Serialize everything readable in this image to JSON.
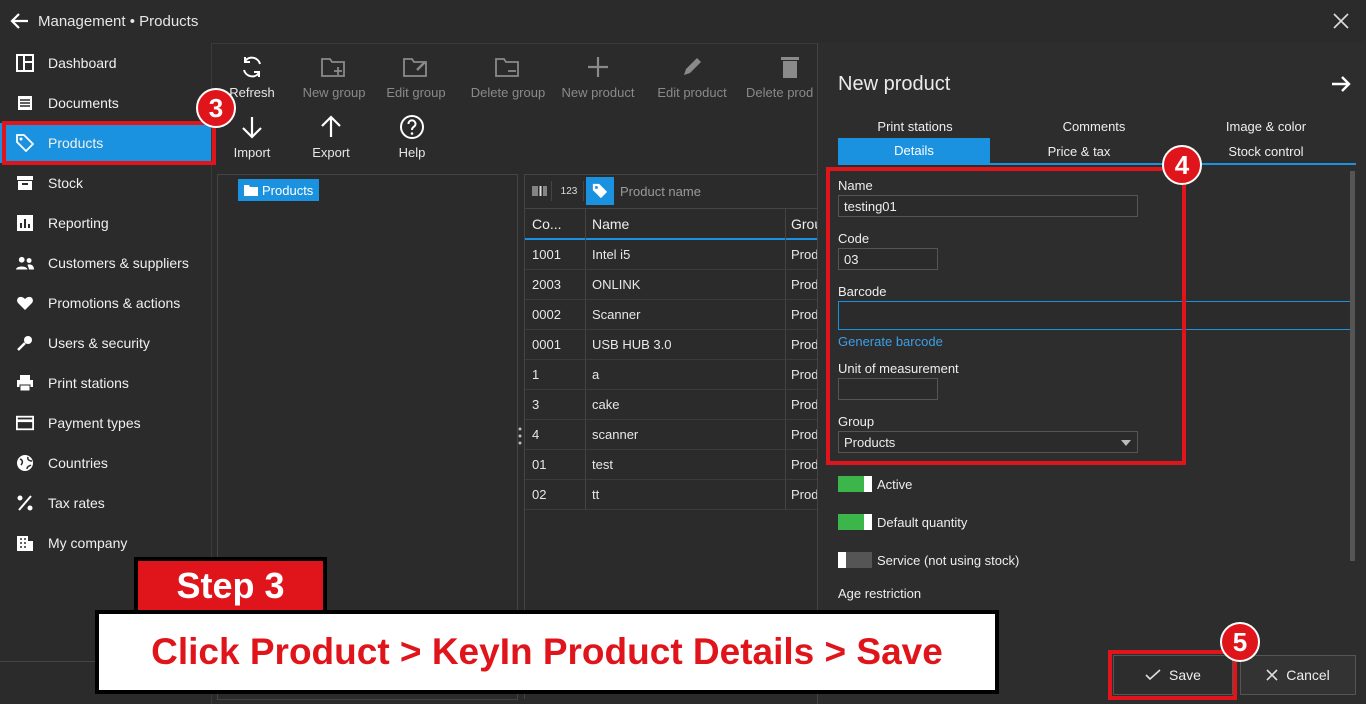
{
  "window": {
    "title": "Management • Products"
  },
  "sidebar": {
    "items": [
      {
        "label": "Dashboard",
        "icon": "dashboard-icon"
      },
      {
        "label": "Documents",
        "icon": "documents-icon"
      },
      {
        "label": "Products",
        "icon": "tag-icon"
      },
      {
        "label": "Stock",
        "icon": "stock-icon"
      },
      {
        "label": "Reporting",
        "icon": "chart-icon"
      },
      {
        "label": "Customers & suppliers",
        "icon": "people-icon"
      },
      {
        "label": "Promotions & actions",
        "icon": "heart-icon"
      },
      {
        "label": "Users & security",
        "icon": "key-icon"
      },
      {
        "label": "Print stations",
        "icon": "printer-icon"
      },
      {
        "label": "Payment types",
        "icon": "card-icon"
      },
      {
        "label": "Countries",
        "icon": "globe-icon"
      },
      {
        "label": "Tax rates",
        "icon": "percent-icon"
      },
      {
        "label": "My company",
        "icon": "building-icon"
      }
    ],
    "active_index": 2
  },
  "toolbar": {
    "refresh": "Refresh",
    "new_group": "New group",
    "edit_group": "Edit group",
    "delete_group": "Delete group",
    "new_product": "New product",
    "edit_product": "Edit product",
    "delete_product": "Delete prod",
    "import": "Import",
    "export": "Export",
    "help": "Help"
  },
  "tree": {
    "root": "Products"
  },
  "grid": {
    "num_label": "123",
    "search_placeholder": "Product name",
    "columns": [
      "Co...",
      "Name",
      "Grou"
    ],
    "rows": [
      {
        "code": "1001",
        "name": "Intel i5",
        "group": "Prod"
      },
      {
        "code": "2003",
        "name": "ONLINK",
        "group": "Prod"
      },
      {
        "code": "0002",
        "name": "Scanner",
        "group": "Prod"
      },
      {
        "code": "0001",
        "name": "USB HUB 3.0",
        "group": "Prod"
      },
      {
        "code": "1",
        "name": "a",
        "group": "Prod"
      },
      {
        "code": "3",
        "name": "cake",
        "group": "Prod"
      },
      {
        "code": "4",
        "name": "scanner",
        "group": "Prod"
      },
      {
        "code": "01",
        "name": "test",
        "group": "Prod"
      },
      {
        "code": "02",
        "name": "tt",
        "group": "Prod"
      }
    ]
  },
  "form": {
    "title": "New product",
    "tabs_row1": [
      "Print stations",
      "Comments",
      "Image & color"
    ],
    "tabs_row2": [
      "Details",
      "Price & tax",
      "Stock control"
    ],
    "name_label": "Name",
    "name_value": "testing01",
    "code_label": "Code",
    "code_value": "03",
    "barcode_label": "Barcode",
    "barcode_value": "",
    "generate_barcode": "Generate barcode",
    "uom_label": "Unit of measurement",
    "uom_value": "",
    "group_label": "Group",
    "group_value": "Products",
    "active_label": "Active",
    "active_on": true,
    "default_qty_label": "Default quantity",
    "default_qty_on": true,
    "service_label": "Service (not using stock)",
    "service_on": false,
    "age_label": "Age restriction",
    "save": "Save",
    "cancel": "Cancel"
  },
  "annotations": {
    "badge3": "3",
    "badge4": "4",
    "badge5": "5",
    "step": "Step 3",
    "instruction": "Click Product > KeyIn Product Details > Save"
  },
  "colors": {
    "accent": "#1b92e0",
    "annotation": "#e0151b",
    "toggle_on": "#3cb54a"
  }
}
